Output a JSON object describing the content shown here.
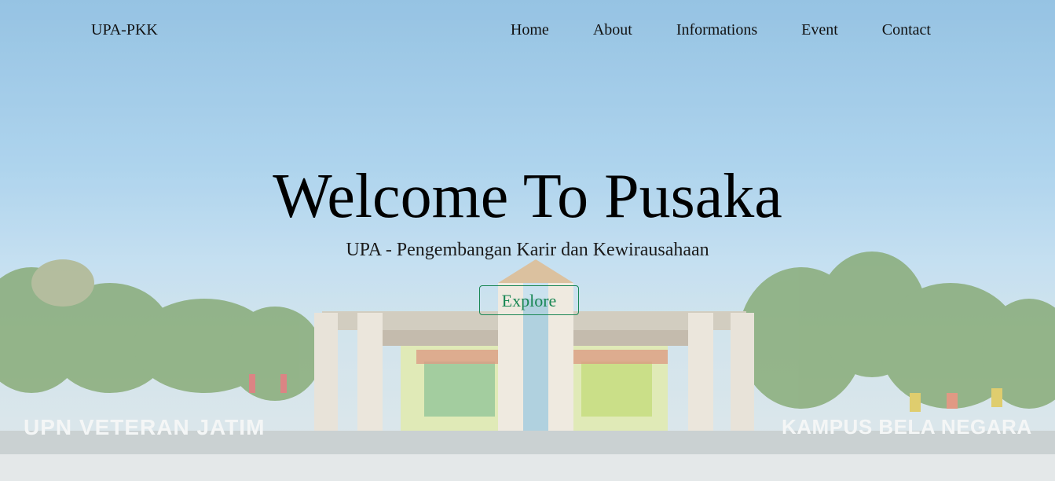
{
  "nav": {
    "brand": "UPA-PKK",
    "items": [
      {
        "label": "Home"
      },
      {
        "label": "About"
      },
      {
        "label": "Informations"
      },
      {
        "label": "Event"
      },
      {
        "label": "Contact"
      }
    ]
  },
  "hero": {
    "title": "Welcome To Pusaka",
    "subtitle": "UPA - Pengembangan Karir dan Kewirausahaan",
    "cta": "Explore",
    "sign_left": "UPN VETERAN JATIM",
    "sign_right": "KAMPUS BELA NEGARA"
  },
  "colors": {
    "cta": "#198754",
    "sky_top": "#7fb6dd",
    "text": "#111111"
  }
}
